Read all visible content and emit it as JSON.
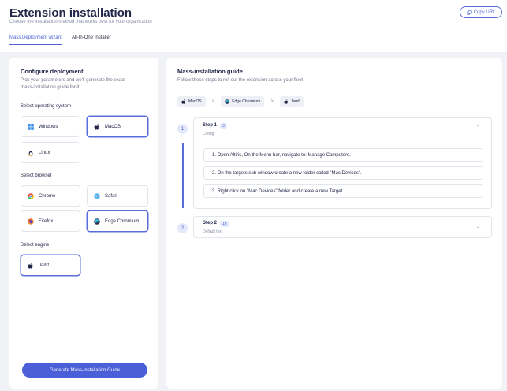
{
  "header": {
    "title": "Extension installation",
    "subtitle": "Choose the installation method that works best for your organization",
    "copy_url": "Copy URL",
    "tabs": [
      {
        "label": "Mass Deployment wizard",
        "active": true
      },
      {
        "label": "All-In-One Installer",
        "active": false
      }
    ]
  },
  "configure": {
    "title": "Configure deployment",
    "desc_line1": "Pick your parameters and we'll generate the exact",
    "desc_line2": "mass-installation guide for it.",
    "os_label": "Select operating system",
    "os": [
      {
        "label": "Windows",
        "icon": "windows-icon",
        "selected": false
      },
      {
        "label": "MacOS",
        "icon": "apple-icon",
        "selected": true
      },
      {
        "label": "Linux",
        "icon": "linux-icon",
        "selected": false
      }
    ],
    "browser_label": "Select browser",
    "browsers": [
      {
        "label": "Chrome",
        "icon": "chrome-icon",
        "selected": false
      },
      {
        "label": "Safari",
        "icon": "safari-icon",
        "selected": false
      },
      {
        "label": "Firefox",
        "icon": "firefox-icon",
        "selected": false
      },
      {
        "label": "Edge Chromium",
        "icon": "edge-icon",
        "selected": true
      }
    ],
    "engine_label": "Select engine",
    "engines": [
      {
        "label": "Jamf",
        "icon": "apple-icon",
        "selected": true
      }
    ],
    "generate_button": "Generate Mass-installation Guide"
  },
  "guide": {
    "title": "Mass-installation guide",
    "desc": "Follow these steps to roll out the extension across your fleet",
    "breadcrumbs": [
      "MacOS",
      "Edge Chromium",
      "Jamf"
    ],
    "breadcrumb_sep": ">",
    "steps": [
      {
        "number": "1",
        "title": "Step 1",
        "count": "3",
        "subtitle": "Config",
        "expanded": true,
        "items": [
          "1. Open Altiris, On the Menu bar, navigate to: Manage Computers.",
          "2. On the targets sub window create a new folder called \"Mac Devices\".",
          "3. Right click on \"Mac Devices\" folder and create a new Target."
        ]
      },
      {
        "number": "2",
        "title": "Step 2",
        "count": "18",
        "subtitle": "Default text",
        "expanded": false,
        "items": []
      }
    ]
  },
  "colors": {
    "accent": "#4d62d6",
    "background": "#f1f2f6",
    "text": "#23274a"
  }
}
